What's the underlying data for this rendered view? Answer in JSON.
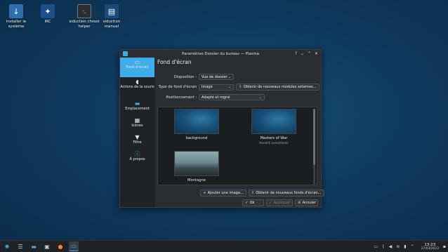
{
  "desktop": {
    "icons": [
      {
        "label": "Installer le système",
        "icon": "download-icon"
      },
      {
        "label": "IRC",
        "icon": "irc-icon"
      },
      {
        "label": "siduction chroot helper",
        "icon": "terminal-icon"
      },
      {
        "label": "siduction manual",
        "icon": "manual-icon"
      }
    ]
  },
  "window": {
    "title": "Paramètres Dossier du bureau — Plasma",
    "controls": [
      "?",
      "⌄",
      "⌃",
      "✕"
    ],
    "sidebar": [
      {
        "label": "Fond d'écran",
        "active": true
      },
      {
        "label": "Actions de la souris",
        "active": false
      },
      {
        "label": "Emplacement",
        "active": false
      },
      {
        "label": "Icônes",
        "active": false
      },
      {
        "label": "Filtre",
        "active": false
      },
      {
        "label": "À propos",
        "active": false
      }
    ],
    "page_title": "Fond d'écran",
    "form": {
      "layout_label": "Disposition :",
      "layout_value": "Vue de dossier",
      "type_label": "Type de fond d'écran",
      "type_value": "Image",
      "get_plugins_label": "Obtenir de nouveaux modules externes...",
      "position_label": "Positionnement :",
      "position_value": "Adapté et rogné"
    },
    "wallpapers": [
      {
        "name": "background",
        "author": ""
      },
      {
        "name": "Masters of War",
        "author": "Hendrik Lenoldiantz"
      },
      {
        "name": "Montagne",
        "author": ""
      }
    ],
    "add_image_label": "Ajouter une image...",
    "get_wallpapers_label": "Obtenir de nouveaux fonds d'écran...",
    "buttons": {
      "ok": "Ok",
      "apply": "Appliquer",
      "cancel": "Annuler"
    }
  },
  "taskbar": {
    "time": "13:23",
    "date": "27/03/2023"
  },
  "colors": {
    "accent": "#3daee9",
    "window_bg": "#2a2e32",
    "taskbar_bg": "#1f2226"
  }
}
